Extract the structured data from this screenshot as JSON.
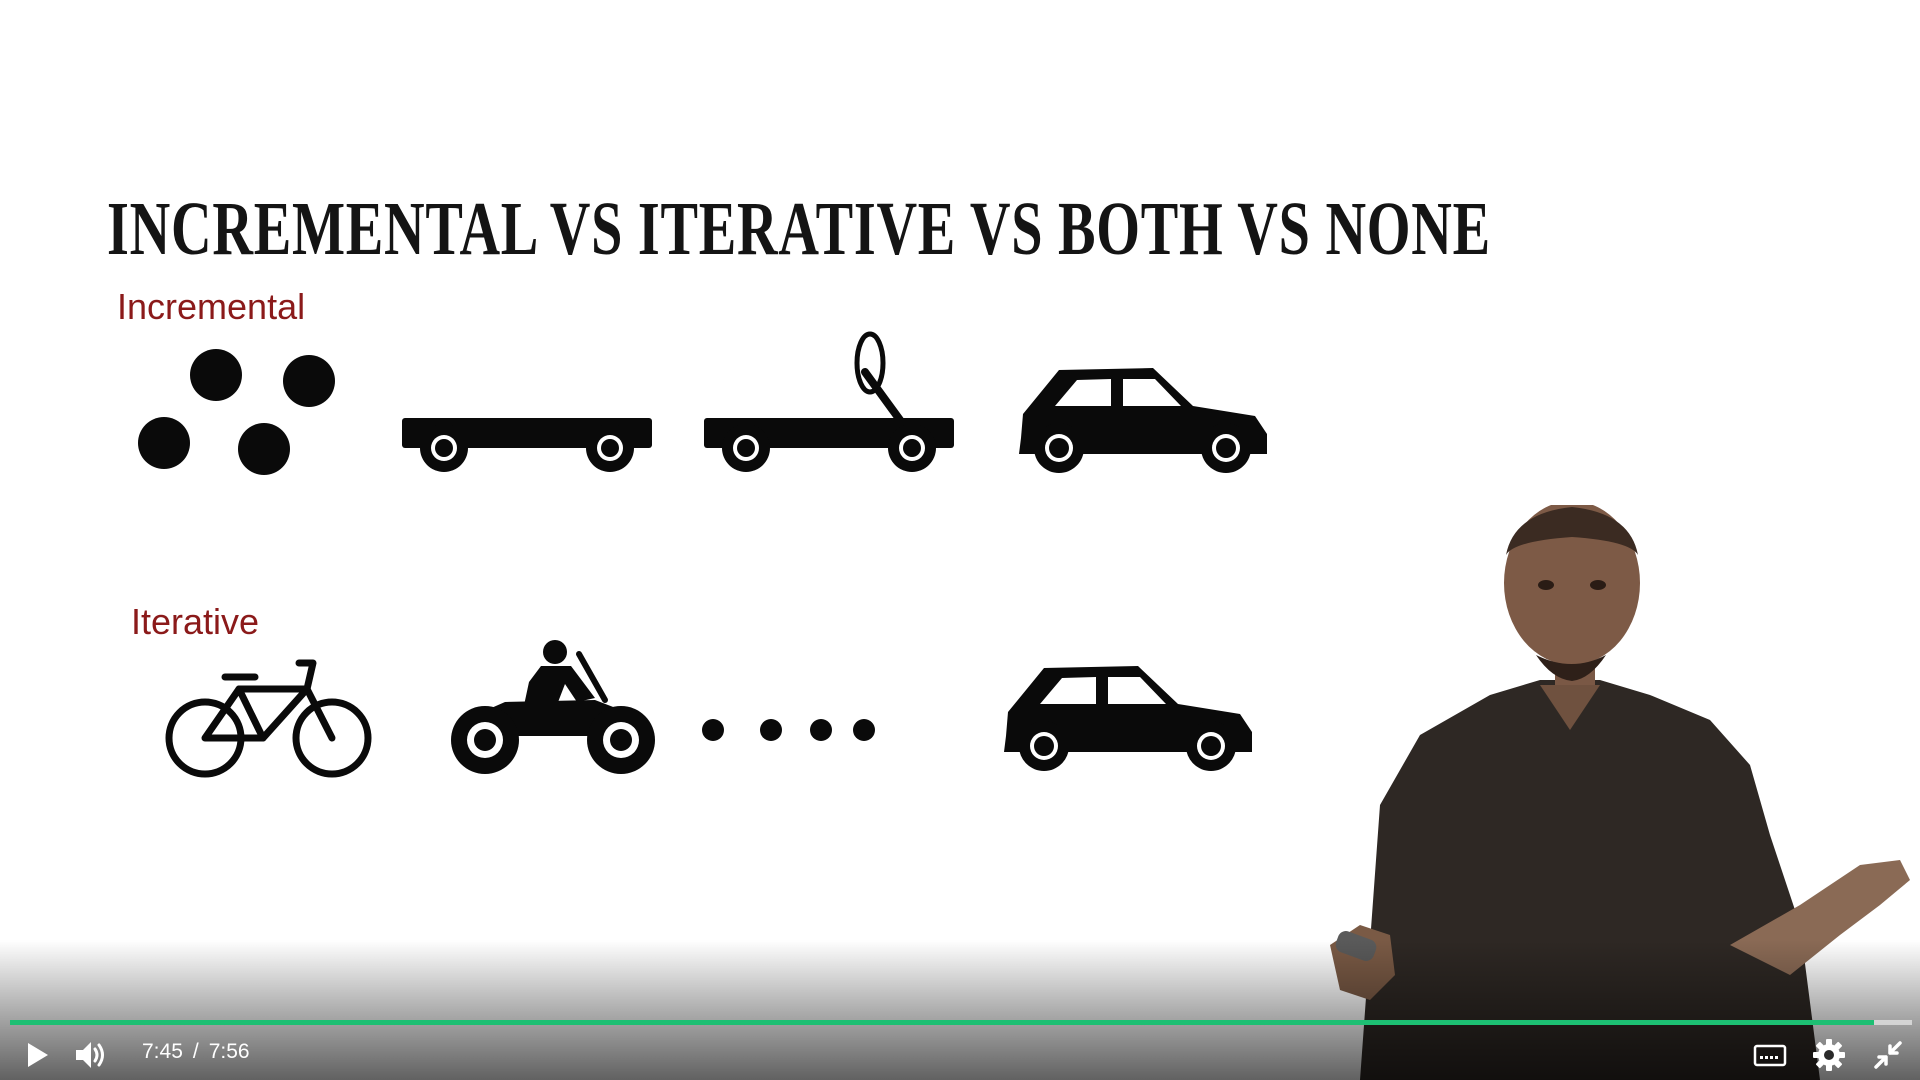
{
  "slide": {
    "title": "INCREMENTAL VS ITERATIVE VS BOTH VS NONE",
    "sections": {
      "incremental": {
        "label": "Incremental",
        "icons": [
          "dots-icon",
          "chassis-icon",
          "chassis-steering-icon",
          "car-icon"
        ]
      },
      "iterative": {
        "label": "Iterative",
        "icons": [
          "bicycle-icon",
          "motorcycle-icon",
          "ellipsis-dots-icon",
          "car-icon"
        ]
      }
    }
  },
  "player": {
    "current_time": "7:45",
    "separator": "/",
    "duration": "7:56",
    "progress_fraction": 0.98,
    "accent_color": "#1dbf73",
    "controls": [
      "play-icon",
      "volume-icon",
      "captions-icon",
      "gear-icon",
      "exit-fullscreen-icon"
    ]
  }
}
